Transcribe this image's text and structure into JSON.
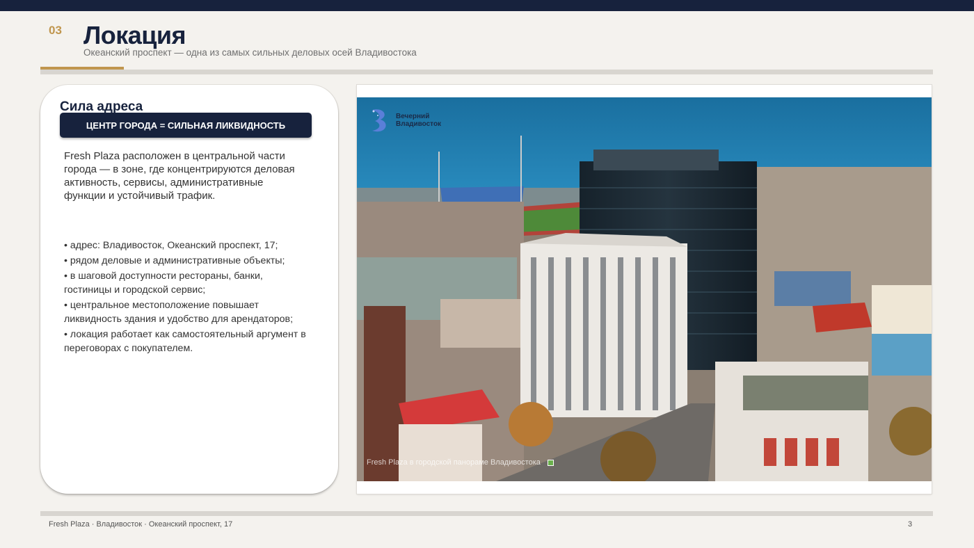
{
  "slide": {
    "number": "03",
    "title": "Локация",
    "subtitle": "Океанский проспект — одна из самых сильных деловых осей Владивостока"
  },
  "card": {
    "heading": "Сила адреса",
    "pill": "ЦЕНТР ГОРОДА = СИЛЬНАЯ ЛИКВИДНОСТЬ",
    "intro": "Fresh Plaza расположен в центральной части города — в зоне, где концентрируются деловая активность, сервисы, административные функции и устойчивый трафик.",
    "bullets": [
      "• адрес: Владивосток, Океанский проспект, 17;",
      "• рядом деловые и административные объекты;",
      "• в шаговой доступности рестораны, банки, гостиницы и городской сервис;",
      "• центральное местоположение повышает ликвидность здания и удобство для арендаторов;",
      "• локация работает как самостоятельный аргумент в переговорах с покупателем."
    ]
  },
  "photo": {
    "logo_line1": "Вечерний",
    "logo_line2": "Владивосток",
    "caption": "Fresh Plaza в городской панораме Владивостока",
    "colors": {
      "sea": "#1f7fb0",
      "tower": "#1d2a33",
      "pitch": "#4f8a3a"
    }
  },
  "footer": {
    "left": "Fresh Plaza · Владивосток · Океанский проспект, 17",
    "page": "3"
  },
  "colors": {
    "navy": "#17223d",
    "gold": "#c0964e",
    "background": "#f4f2ee"
  }
}
